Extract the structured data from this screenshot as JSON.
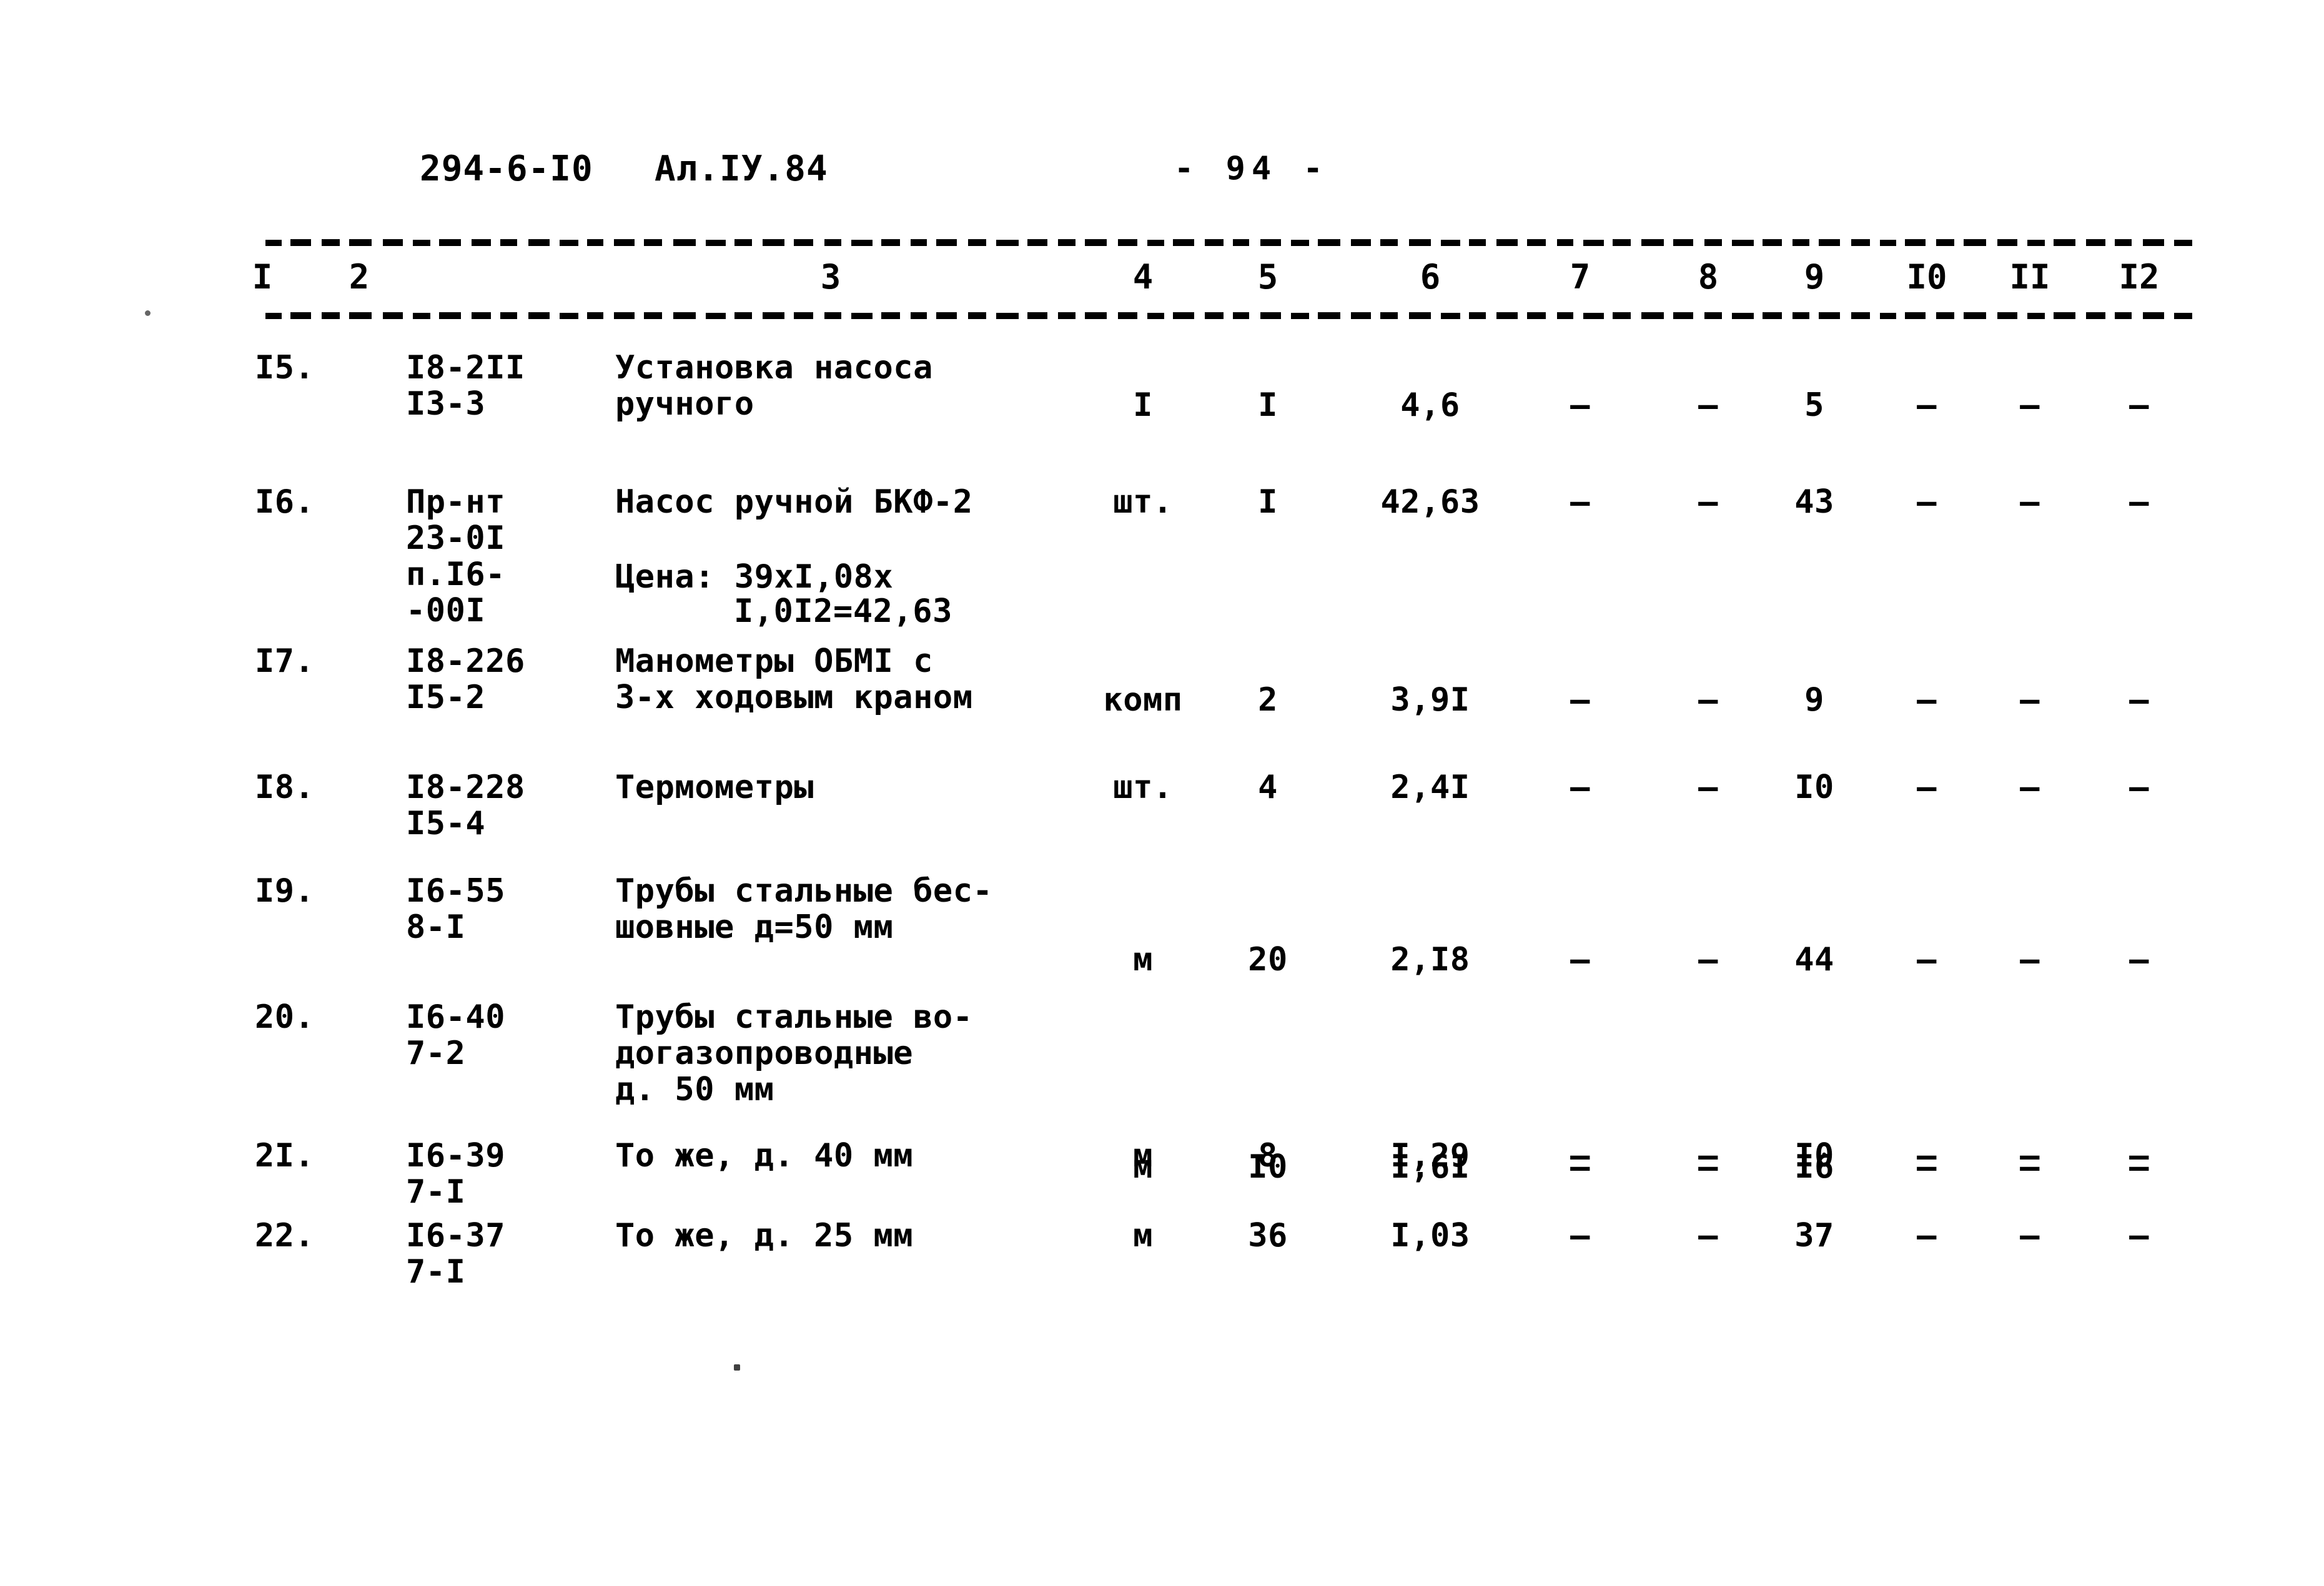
{
  "header": {
    "doc_code": "294-6-I0",
    "album": "Ал.IУ.84",
    "page_label": "- 94 -"
  },
  "table": {
    "column_headers": [
      "I",
      "2",
      "3",
      "4",
      "5",
      "6",
      "7",
      "8",
      "9",
      "I0",
      "II",
      "I2"
    ],
    "rows": [
      {
        "num": "I5.",
        "code": "I8-2II\nI3-3",
        "desc": "Установка насоса\nручного",
        "unit": "I",
        "qty": "I",
        "c6": "4,6",
        "c7": "–",
        "c8": "–",
        "c9": "5",
        "c10": "–",
        "c11": "–",
        "c12": "–"
      },
      {
        "num": "I6.",
        "code": "Пр-нт\n23-0I\nп.I6-\n-00I",
        "desc": "Насос ручной БКФ-2",
        "desc2": "Цена: 39xI,08x",
        "desc3": "I,0I2=42,63",
        "unit": "шт.",
        "qty": "I",
        "c6": "42,63",
        "c7": "–",
        "c8": "–",
        "c9": "43",
        "c10": "–",
        "c11": "–",
        "c12": "–"
      },
      {
        "num": "I7.",
        "code": "I8-226\nI5-2",
        "desc": "Манометры ОБМI с\n3-х ходовым краном",
        "unit": "комп",
        "qty": "2",
        "c6": "3,9I",
        "c7": "–",
        "c8": "–",
        "c9": "9",
        "c10": "–",
        "c11": "–",
        "c12": "–"
      },
      {
        "num": "I8.",
        "code": "I8-228\nI5-4",
        "desc": "Термометры",
        "unit": "шт.",
        "qty": "4",
        "c6": "2,4I",
        "c7": "–",
        "c8": "–",
        "c9": "I0",
        "c10": "–",
        "c11": "–",
        "c12": "–"
      },
      {
        "num": "I9.",
        "code": "I6-55\n8-I",
        "desc": "Трубы стальные бес-\nшовные д=50 мм",
        "unit": "м",
        "qty": "20",
        "c6": "2,I8",
        "c7": "–",
        "c8": "–",
        "c9": "44",
        "c10": "–",
        "c11": "–",
        "c12": "–"
      },
      {
        "num": "20.",
        "code": "I6-40\n7-2",
        "desc": "Трубы стальные во-\nдогазопроводные\nд. 50 мм",
        "unit": "м",
        "qty": "I0",
        "c6": "I,6I",
        "c7": "–",
        "c8": "–",
        "c9": "I6",
        "c10": "–",
        "c11": "–",
        "c12": "–"
      },
      {
        "num": "2I.",
        "code": "I6-39\n7-I",
        "desc": "То же, д. 40 мм",
        "unit": "м",
        "qty": "8",
        "c6": "I,29",
        "c7": "–",
        "c8": "–",
        "c9": "I0",
        "c10": "–",
        "c11": "–",
        "c12": "–"
      },
      {
        "num": "22.",
        "code": "I6-37\n7-I",
        "desc": "То же, д. 25 мм",
        "unit": "м",
        "qty": "36",
        "c6": "I,03",
        "c7": "–",
        "c8": "–",
        "c9": "37",
        "c10": "–",
        "c11": "–",
        "c12": "–"
      }
    ]
  }
}
